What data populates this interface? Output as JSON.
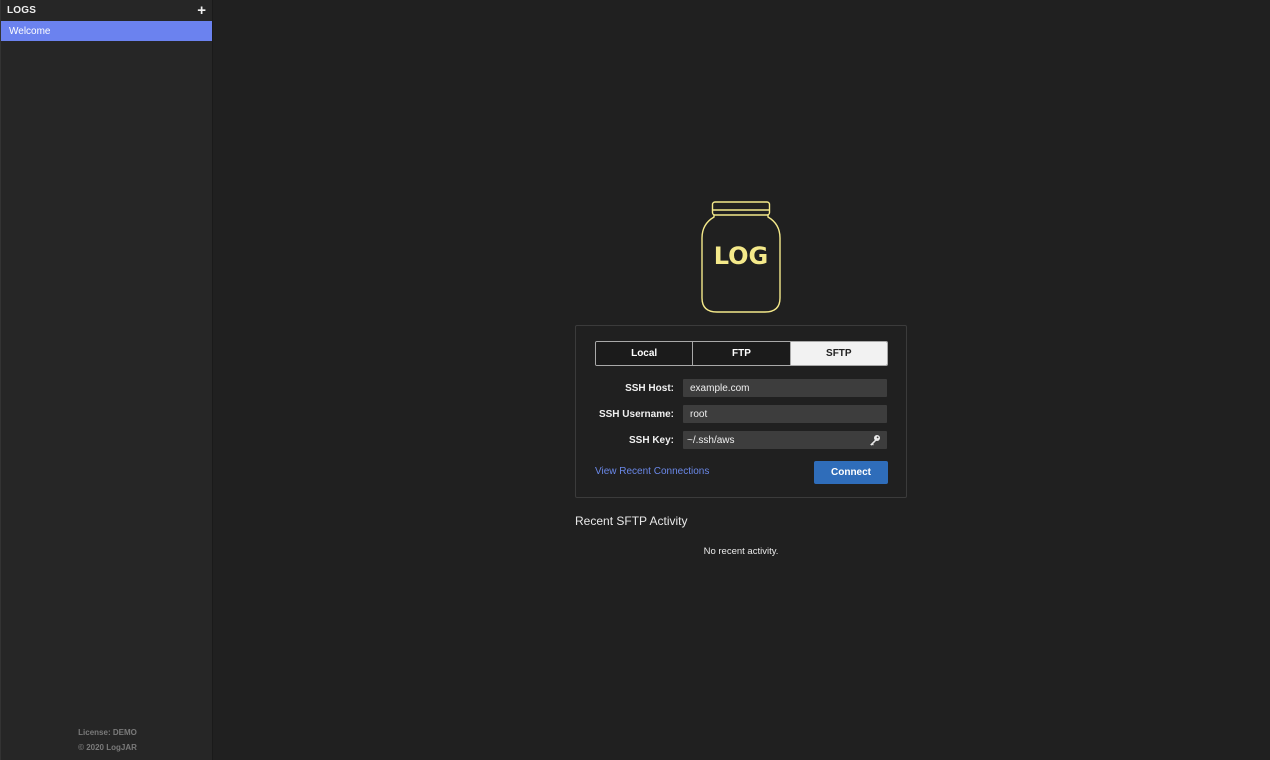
{
  "sidebar": {
    "title": "LOGS",
    "add_icon": "+",
    "items": [
      {
        "label": "Welcome"
      }
    ],
    "license": "License: DEMO",
    "copyright": "© 2020 LogJAR"
  },
  "logo": {
    "text": "LOG",
    "color": "#f4e98a"
  },
  "connection": {
    "tabs": [
      {
        "label": "Local"
      },
      {
        "label": "FTP"
      },
      {
        "label": "SFTP",
        "active": true
      }
    ],
    "fields": {
      "host": {
        "label": "SSH Host:",
        "value": "example.com"
      },
      "username": {
        "label": "SSH Username:",
        "value": "root"
      },
      "key": {
        "label": "SSH Key:",
        "value": "~/.ssh/aws",
        "icon": "key-icon"
      }
    },
    "recent_link": "View Recent Connections",
    "connect_label": "Connect"
  },
  "activity": {
    "title": "Recent SFTP Activity",
    "empty": "No recent activity."
  },
  "colors": {
    "accent": "#6b82ef",
    "button": "#2f6dba",
    "link": "#6a88e8",
    "background": "#202020"
  }
}
